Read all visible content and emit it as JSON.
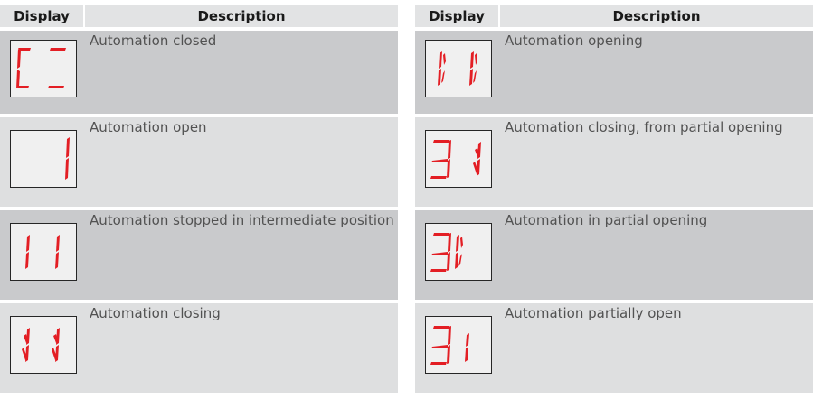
{
  "headers": {
    "display": "Display",
    "description": "Description"
  },
  "left_rows": [
    {
      "description": "Automation closed",
      "display_icon": "lcd-closed-icon"
    },
    {
      "description": "Automation open",
      "display_icon": "lcd-open-icon"
    },
    {
      "description": "Automation stopped in intermediate position",
      "display_icon": "lcd-stopped-icon"
    },
    {
      "description": "Automation closing",
      "display_icon": "lcd-closing-icon"
    }
  ],
  "right_rows": [
    {
      "description": "Automation opening",
      "display_icon": "lcd-opening-icon"
    },
    {
      "description": "Automation closing, from partial opening",
      "display_icon": "lcd-closing-partial-icon"
    },
    {
      "description": "Automation in partial opening",
      "display_icon": "lcd-partial-opening-icon"
    },
    {
      "description": "Automation partially open",
      "display_icon": "lcd-partially-open-icon"
    }
  ],
  "colors": {
    "segment": "#e31e24",
    "row_dark": "#c9cacc",
    "row_light": "#dedfe0",
    "header": "#e2e3e4"
  }
}
